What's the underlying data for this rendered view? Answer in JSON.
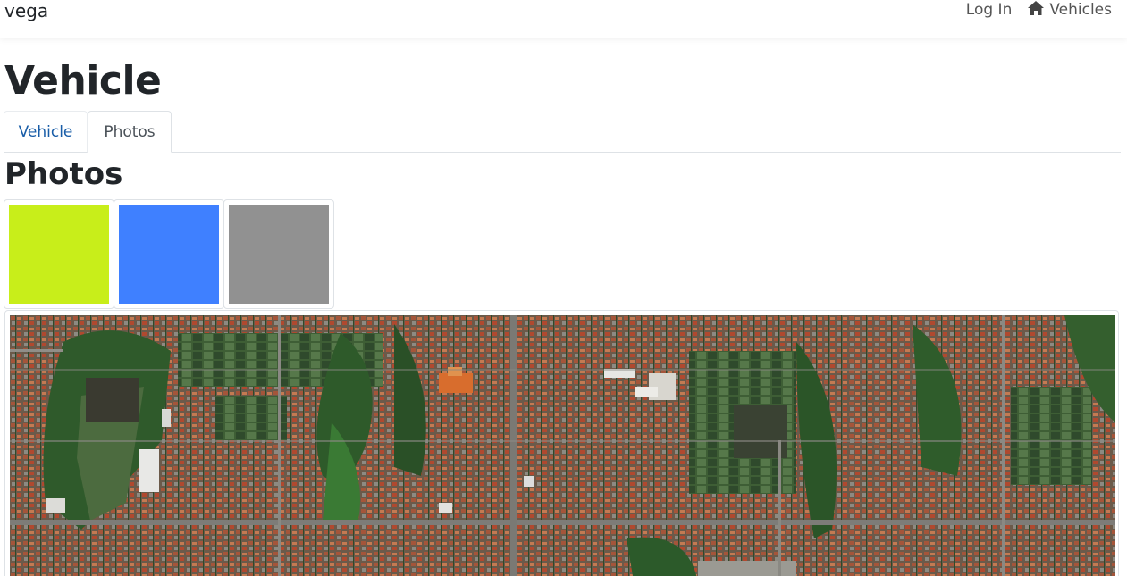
{
  "navbar": {
    "brand": "vega",
    "login_label": "Log In",
    "vehicles_label": "Vehicles",
    "vehicles_icon": "home-icon"
  },
  "page": {
    "title": "Vehicle"
  },
  "tabs": [
    {
      "label": "Vehicle",
      "active": false
    },
    {
      "label": "Photos",
      "active": true
    }
  ],
  "photos": {
    "section_title": "Photos",
    "thumbnails": [
      {
        "color": "#c8ee1a"
      },
      {
        "color": "#3f80ff"
      },
      {
        "color": "#919191"
      }
    ],
    "main_photo": "aerial satellite view of dense urban area"
  }
}
